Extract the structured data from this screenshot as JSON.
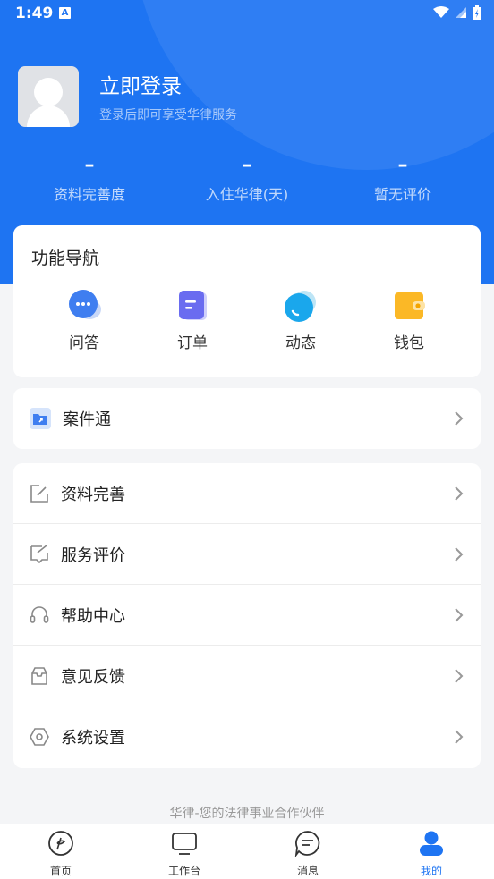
{
  "status_bar": {
    "time": "1:49",
    "notification_badge": "A"
  },
  "profile": {
    "title": "立即登录",
    "subtitle": "登录后即可享受华律服务"
  },
  "stats": [
    {
      "value": "–",
      "label": "资料完善度"
    },
    {
      "value": "–",
      "label": "入住华律(天)"
    },
    {
      "value": "–",
      "label": "暂无评价"
    }
  ],
  "nav": {
    "title": "功能导航",
    "items": [
      {
        "label": "问答",
        "icon": "chat-bubble-icon"
      },
      {
        "label": "订单",
        "icon": "order-doc-icon"
      },
      {
        "label": "动态",
        "icon": "moments-icon"
      },
      {
        "label": "钱包",
        "icon": "wallet-icon"
      }
    ]
  },
  "case": {
    "label": "案件通",
    "icon": "folder-icon"
  },
  "menu": [
    {
      "label": "资料完善",
      "icon": "edit-icon"
    },
    {
      "label": "服务评价",
      "icon": "rate-icon"
    },
    {
      "label": "帮助中心",
      "icon": "headset-icon"
    },
    {
      "label": "意见反馈",
      "icon": "inbox-icon"
    },
    {
      "label": "系统设置",
      "icon": "settings-icon"
    }
  ],
  "slogan": "华律-您的法律事业合作伙伴",
  "tabs": [
    {
      "label": "首页",
      "icon": "home-icon"
    },
    {
      "label": "工作台",
      "icon": "monitor-icon"
    },
    {
      "label": "消息",
      "icon": "message-icon"
    },
    {
      "label": "我的",
      "icon": "profile-icon",
      "active": true
    }
  ],
  "colors": {
    "brand": "#1e74f2",
    "background": "#f4f5f7"
  }
}
